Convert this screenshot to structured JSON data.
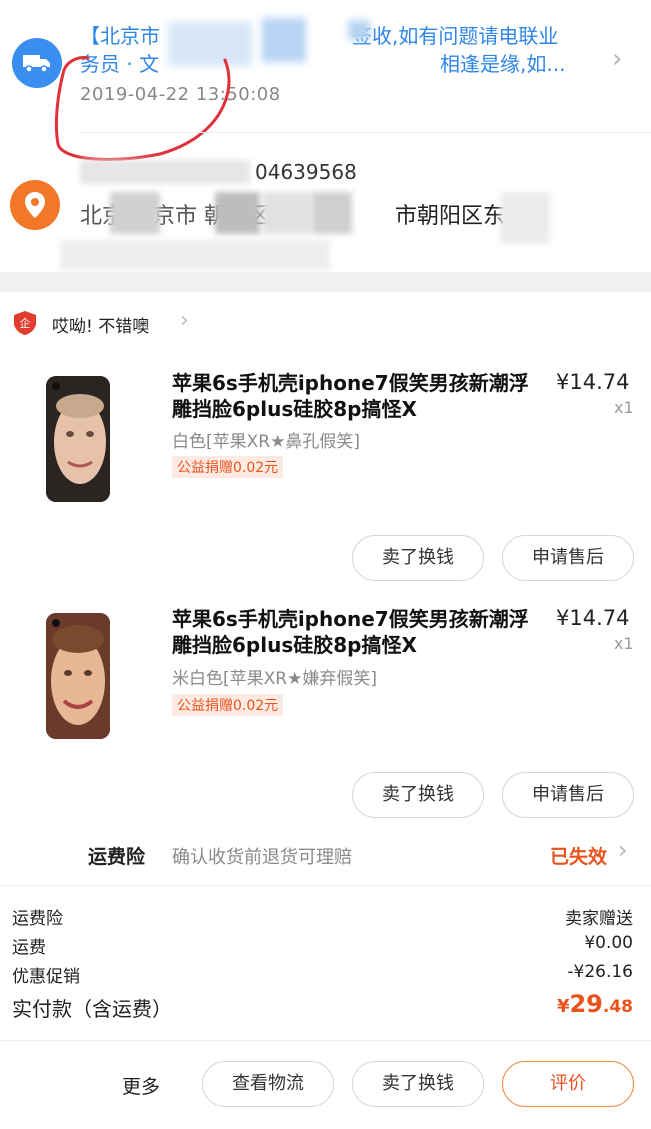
{
  "logistics": {
    "line1_left": "【北京市",
    "line1_right": "签收,如有问题请电联业",
    "line2_left": "务员 · 文",
    "line2_right": "相逢是缘,如...",
    "timestamp": "2019-04-22 13:50:08",
    "icon": "truck-icon",
    "accent": "#3a8ef0",
    "annotation_color": "#e0303a"
  },
  "address": {
    "phone_partial": "04639568",
    "line_left": "北京 北京市 朝阳区",
    "line_right": "市朝阳区东",
    "icon": "location-pin-icon",
    "accent": "#f27726"
  },
  "shop": {
    "name": "哎呦! 不错噢",
    "icon": "shop-badge-icon"
  },
  "items": [
    {
      "title_line1": "苹果6s手机壳iphone7假笑男孩新潮浮",
      "title_line2": "雕挡脸6plus硅胶8p搞怪X",
      "sku": "白色[苹果XR★鼻孔假笑]",
      "charity": "公益捐赠0.02元",
      "price": "¥14.74",
      "qty": "x1",
      "btn_sell": "卖了换钱",
      "btn_aftersale": "申请售后"
    },
    {
      "title_line1": "苹果6s手机壳iphone7假笑男孩新潮浮",
      "title_line2": "雕挡脸6plus硅胶8p搞怪X",
      "sku": "米白色[苹果XR★嫌弃假笑]",
      "charity": "公益捐赠0.02元",
      "price": "¥14.74",
      "qty": "x1",
      "btn_sell": "卖了换钱",
      "btn_aftersale": "申请售后"
    }
  ],
  "shipping_insurance": {
    "label": "运费险",
    "desc": "确认收货前退货可理赔",
    "status": "已失效"
  },
  "summary": {
    "rows": [
      {
        "label": "运费险",
        "value": "卖家赠送"
      },
      {
        "label": "运费",
        "value": "¥0.00"
      },
      {
        "label": "优惠促销",
        "value": "-¥26.16"
      }
    ],
    "total_label": "实付款（含运费）",
    "total_currency": "¥",
    "total_int": "29",
    "total_dec": ".48"
  },
  "bottom_bar": {
    "more": "更多",
    "view_logistics": "查看物流",
    "sell": "卖了换钱",
    "review": "评价"
  }
}
